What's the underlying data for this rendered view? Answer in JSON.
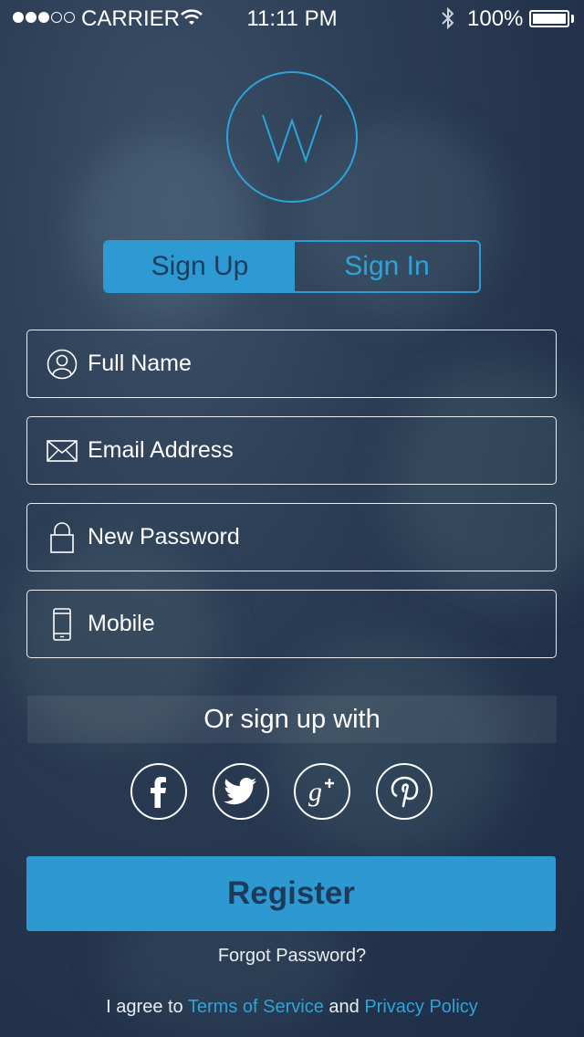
{
  "status_bar": {
    "carrier": "CARRIER",
    "time": "11:11 PM",
    "battery": "100%",
    "signal_dots_filled": 3,
    "signal_dots_total": 5
  },
  "logo": {
    "letter": "W"
  },
  "tabs": [
    {
      "label": "Sign Up",
      "active": true
    },
    {
      "label": "Sign In",
      "active": false
    }
  ],
  "form": {
    "full_name": {
      "placeholder": "Full Name",
      "icon": "user-icon",
      "value": ""
    },
    "email": {
      "placeholder": "Email Address",
      "icon": "envelope-icon",
      "value": ""
    },
    "password": {
      "placeholder": "New Password",
      "icon": "lock-icon",
      "value": ""
    },
    "mobile": {
      "placeholder": "Mobile",
      "icon": "mobile-icon",
      "value": ""
    }
  },
  "social": {
    "heading": "Or sign up with",
    "providers": [
      {
        "name": "facebook",
        "icon": "facebook-icon"
      },
      {
        "name": "twitter",
        "icon": "twitter-icon"
      },
      {
        "name": "google-plus",
        "icon": "google-plus-icon"
      },
      {
        "name": "pinterest",
        "icon": "pinterest-icon"
      }
    ]
  },
  "register_label": "Register",
  "forgot_password": "Forgot Password?",
  "terms": {
    "prefix": "I agree to",
    "terms_link": "Terms of Service",
    "conjunction": "and",
    "privacy_link": "Privacy Policy"
  },
  "colors": {
    "accent": "#2e9ad2",
    "button_text": "#1c3b5b",
    "background": "#2c3e55"
  }
}
